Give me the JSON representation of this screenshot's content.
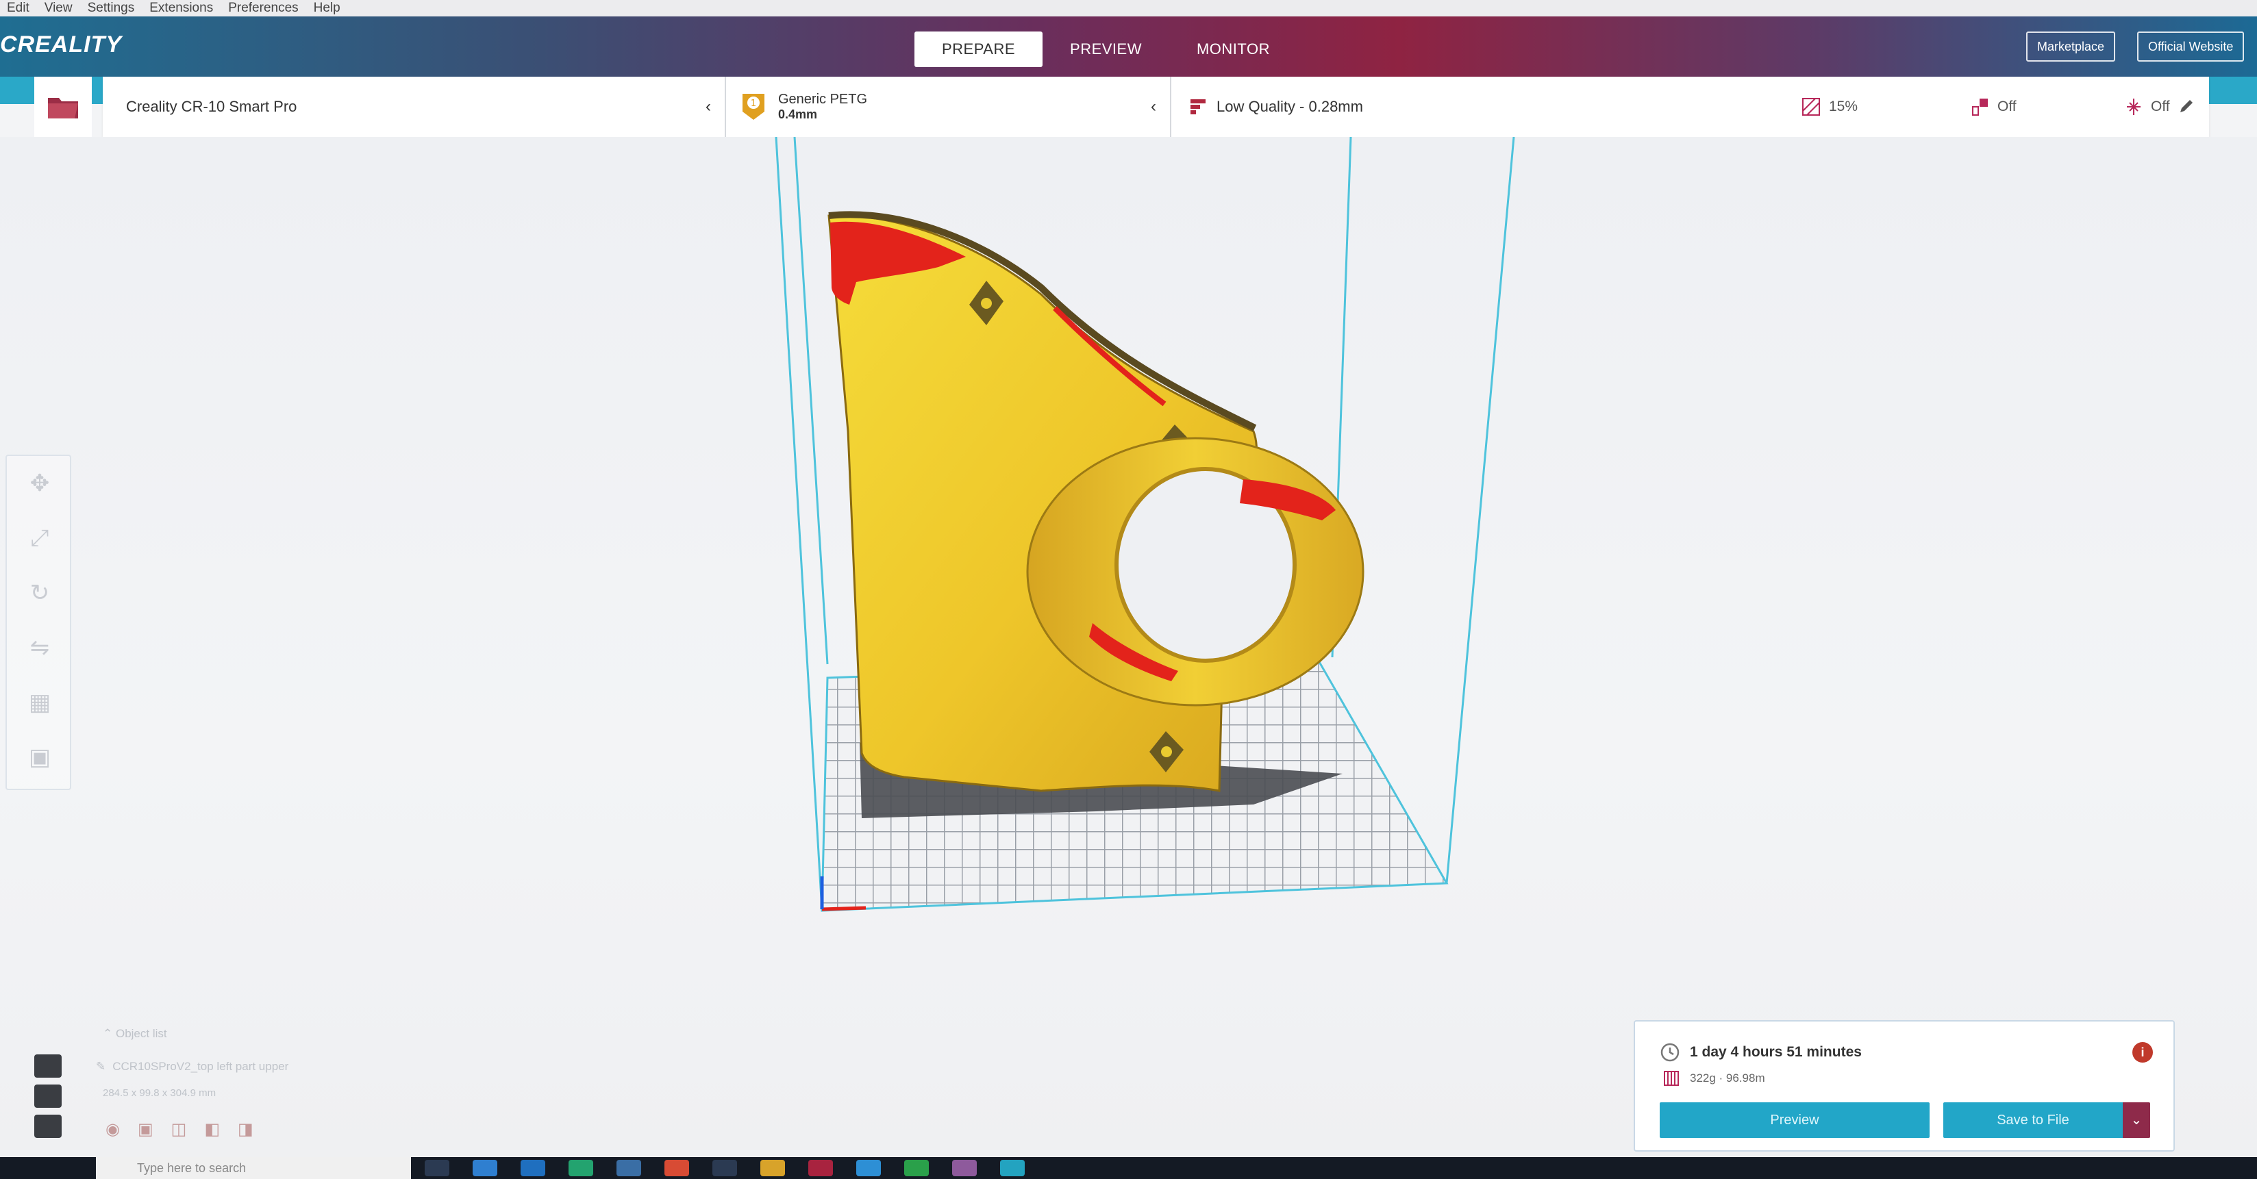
{
  "menu": [
    "Edit",
    "View",
    "Settings",
    "Extensions",
    "Preferences",
    "Help"
  ],
  "header": {
    "logo": "CREALITY",
    "stages": [
      {
        "label": "PREPARE",
        "active": true
      },
      {
        "label": "PREVIEW",
        "active": false
      },
      {
        "label": "MONITOR",
        "active": false
      }
    ],
    "marketplace": "Marketplace",
    "official_website": "Official Website"
  },
  "toolbar": {
    "printer": "Creality CR-10 Smart Pro",
    "material_name": "Generic PETG",
    "material_nozzle": "0.4mm",
    "material_badge": "1",
    "quality": "Low Quality - 0.28mm",
    "infill": "15%",
    "support": "Off",
    "adhesion": "Off"
  },
  "object_list": {
    "header": "Object list",
    "name": "CCR10SProV2_top left part upper",
    "dimensions": "284.5 x 99.8 x 304.9 mm"
  },
  "print_job": {
    "time": "1 day 4 hours 51 minutes",
    "material": "322g · 96.98m",
    "preview_button": "Preview",
    "save_button": "Save to File"
  },
  "taskbar": {
    "search_placeholder": "Type here to search"
  },
  "colors": {
    "accent": "#2aa8c8",
    "model": "#f2d32a",
    "overhang": "#e3231b",
    "header_mid": "#8f2342"
  }
}
